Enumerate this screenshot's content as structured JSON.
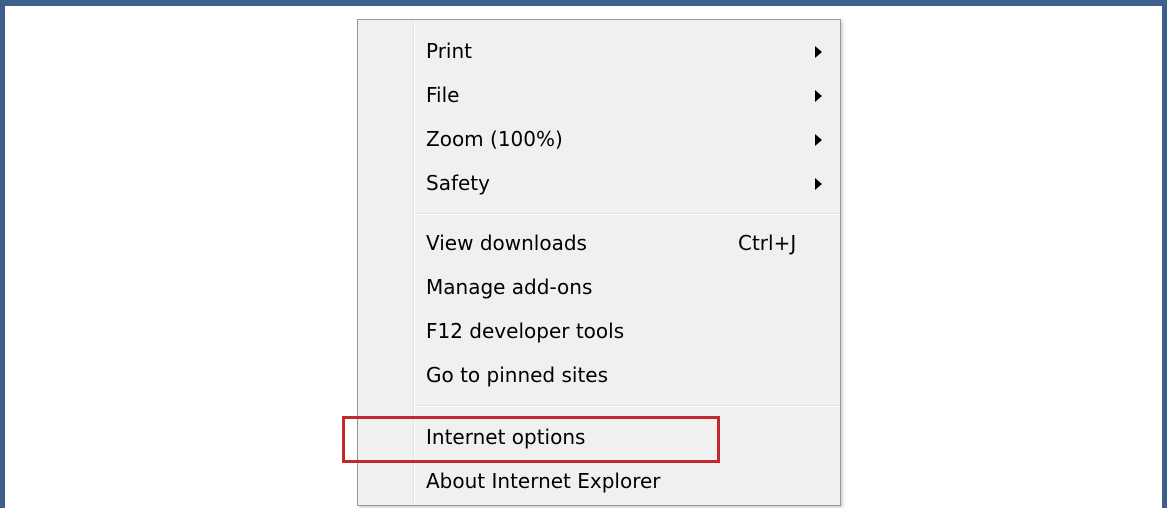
{
  "menu": {
    "items": [
      {
        "label": "Print",
        "has_submenu": true
      },
      {
        "label": "File",
        "has_submenu": true
      },
      {
        "label": "Zoom (100%)",
        "has_submenu": true
      },
      {
        "label": "Safety",
        "has_submenu": true
      },
      {
        "label": "View downloads",
        "shortcut": "Ctrl+J"
      },
      {
        "label": "Manage add-ons"
      },
      {
        "label": "F12 developer tools"
      },
      {
        "label": "Go to pinned sites"
      },
      {
        "label": "Internet options",
        "highlighted": true
      },
      {
        "label": "About Internet Explorer"
      }
    ]
  },
  "colors": {
    "frame_border": "#3c5f8c",
    "highlight_border": "#c0282e",
    "menu_background": "#f0f0f0"
  }
}
